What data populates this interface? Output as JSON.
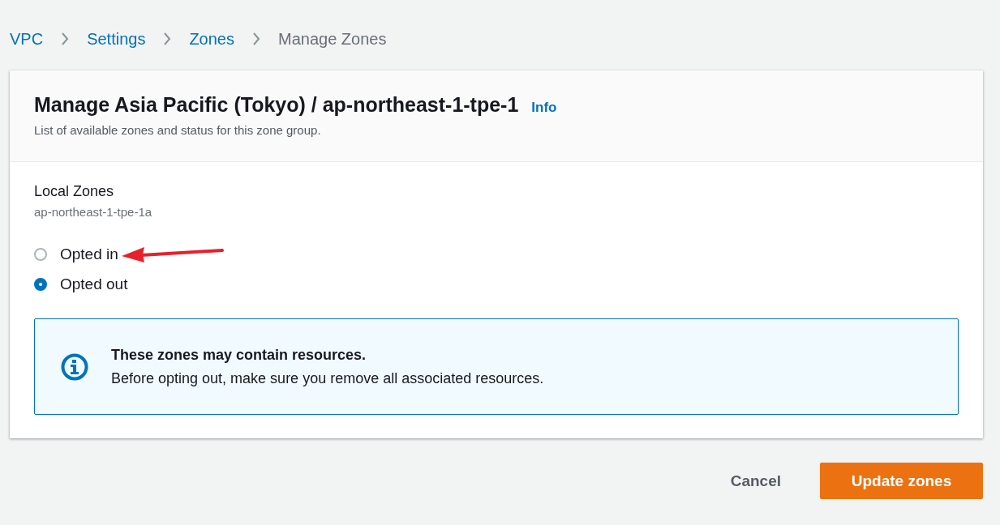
{
  "breadcrumb": [
    {
      "label": "VPC",
      "current": false
    },
    {
      "label": "Settings",
      "current": false
    },
    {
      "label": "Zones",
      "current": false
    },
    {
      "label": "Manage Zones",
      "current": true
    }
  ],
  "panel": {
    "title": "Manage Asia Pacific (Tokyo) / ap-northeast-1-tpe-1",
    "info_link": "Info",
    "description": "List of available zones and status for this zone group."
  },
  "field": {
    "label": "Local Zones",
    "description": "ap-northeast-1-tpe-1a"
  },
  "options": [
    {
      "label": "Opted in",
      "selected": false
    },
    {
      "label": "Opted out",
      "selected": true
    }
  ],
  "alert": {
    "title": "These zones may contain resources.",
    "message": "Before opting out, make sure you remove all associated resources."
  },
  "buttons": {
    "cancel": "Cancel",
    "primary": "Update zones"
  }
}
